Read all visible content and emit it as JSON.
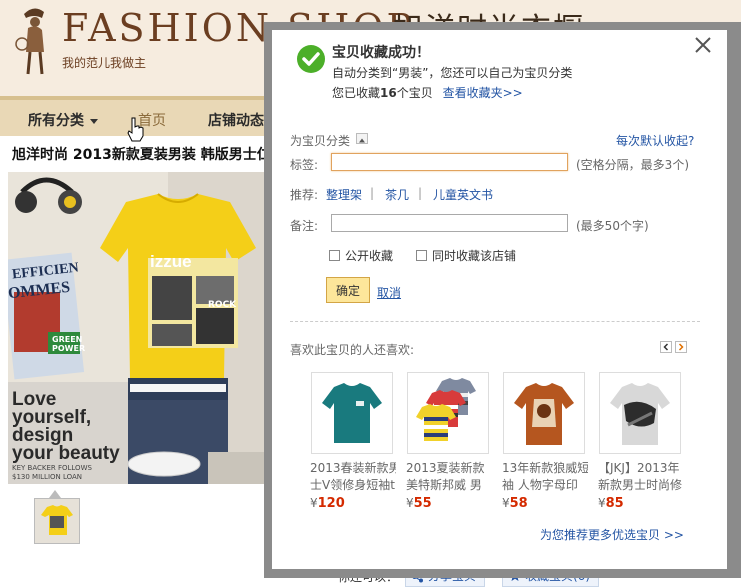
{
  "header": {
    "brand": "FASHION SHOP",
    "tagline": "我的范儿我做主",
    "shop_name_cn": "旭洋时尚衣橱"
  },
  "nav": {
    "all_categories": "所有分类",
    "home": "首页",
    "shop_news": "店铺动态"
  },
  "product": {
    "title": "旭洋时尚 2013新款夏装男装 韩版男士仁"
  },
  "share": {
    "label": "你还可以：",
    "share_btn": "分享宝贝",
    "fav_btn": "收藏宝贝(6)"
  },
  "modal": {
    "success_title": "宝贝收藏成功！",
    "auto_category_line": "自动分类到“男装”，您还可以自己为宝贝分类",
    "count_prefix": "您已收藏",
    "count_value": "16",
    "count_suffix": "个宝贝",
    "view_favorites": "查看收藏夹>>",
    "categorize_label": "为宝贝分类",
    "default_collect_link": "每次默认收起?",
    "tag_label": "标签:",
    "tag_value": "",
    "tag_hint": "(空格分隔，最多3个)",
    "recommend_label": "推荐:",
    "recommend_tags": [
      "整理架",
      "茶几",
      "儿童英文书"
    ],
    "note_label": "备注:",
    "note_value": "",
    "note_hint": "(最多50个字)",
    "public_collect": "公开收藏",
    "collect_shop": "同时收藏该店铺",
    "confirm": "确定",
    "cancel": "取消",
    "also_like_title": "喜欢此宝贝的人还喜欢:",
    "more_recommend": "为您推荐更多优选宝贝 >>",
    "items": [
      {
        "line1": "2013春装新款男",
        "line2": "士V领修身短袖t",
        "currency": "¥",
        "price": "120"
      },
      {
        "line1": "2013夏装新款",
        "line2": "美特斯邦威 男",
        "currency": "¥",
        "price": "55"
      },
      {
        "line1": "13年新款狼威短",
        "line2": "袖 人物字母印",
        "currency": "¥",
        "price": "58"
      },
      {
        "line1": "【JKJ】2013年",
        "line2": "新款男士时尚修",
        "currency": "¥",
        "price": "85"
      }
    ]
  },
  "product_image_text": {
    "magazine1": "EFFICIEN",
    "magazine2": "OMMES",
    "magazine3": "GREEN",
    "magazine4": "POWER",
    "poster1": "Love",
    "poster2": "yourself,",
    "poster3": "design",
    "poster4": "your beauty",
    "poster5": "KEY BACKER FOLLOWS",
    "poster6": "$130 MILLION LOAN",
    "shirt_brand": "izzue",
    "shirt_word": "ROCK"
  },
  "colors": {
    "shirt_yellow": "#f4cf18",
    "price_red": "#d42a00",
    "link_blue": "#2455a4",
    "header_bg": "#f6ecdf",
    "nav_bg": "#e9d8b6"
  }
}
